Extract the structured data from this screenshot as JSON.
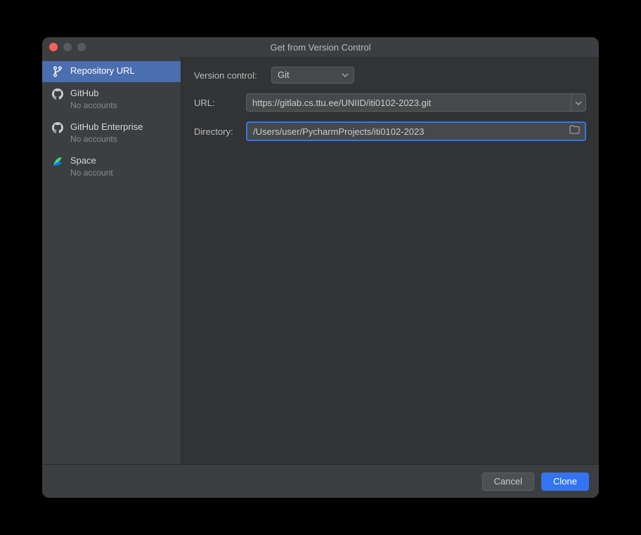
{
  "title": "Get from Version Control",
  "sidebar": {
    "items": [
      {
        "label": "Repository URL"
      },
      {
        "label": "GitHub",
        "sub": "No accounts"
      },
      {
        "label": "GitHub Enterprise",
        "sub": "No accounts"
      },
      {
        "label": "Space",
        "sub": "No account"
      }
    ]
  },
  "form": {
    "vc_label": "Version control:",
    "vc_value": "Git",
    "url_label": "URL:",
    "url_value": "https://gitlab.cs.ttu.ee/UNIID/iti0102-2023.git",
    "dir_label": "Directory:",
    "dir_value": "/Users/user/PycharmProjects/iti0102-2023"
  },
  "footer": {
    "cancel": "Cancel",
    "clone": "Clone"
  }
}
